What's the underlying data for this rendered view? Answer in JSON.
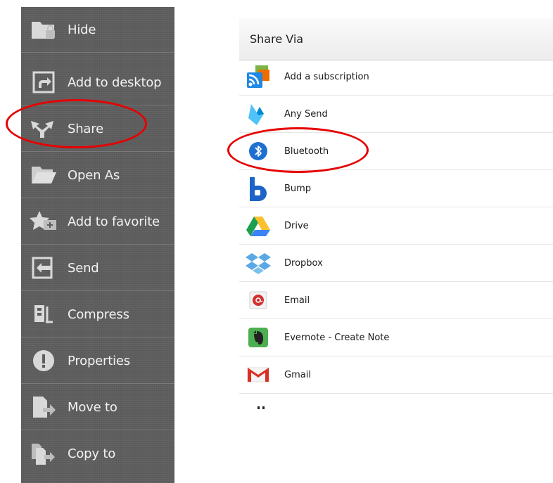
{
  "menu": {
    "items": [
      {
        "label": "Hide",
        "icon": "folder-lock-icon"
      },
      {
        "label": "Add to desktop",
        "icon": "shortcut-icon"
      },
      {
        "label": "Share",
        "icon": "share-icon"
      },
      {
        "label": "Open As",
        "icon": "open-folder-icon"
      },
      {
        "label": "Add to favorite",
        "icon": "star-icon"
      },
      {
        "label": "Send",
        "icon": "send-icon"
      },
      {
        "label": "Compress",
        "icon": "compress-icon"
      },
      {
        "label": "Properties",
        "icon": "info-icon"
      },
      {
        "label": "Move to",
        "icon": "move-icon"
      },
      {
        "label": "Copy to",
        "icon": "copy-icon"
      }
    ]
  },
  "share": {
    "title": "Share Via",
    "items": [
      {
        "label": "Add a subscription",
        "icon": "rss-subscription-icon"
      },
      {
        "label": "Any Send",
        "icon": "any-send-icon"
      },
      {
        "label": "Bluetooth",
        "icon": "bluetooth-icon"
      },
      {
        "label": "Bump",
        "icon": "bump-icon"
      },
      {
        "label": "Drive",
        "icon": "drive-icon"
      },
      {
        "label": "Dropbox",
        "icon": "dropbox-icon"
      },
      {
        "label": "Email",
        "icon": "email-icon"
      },
      {
        "label": "Evernote - Create Note",
        "icon": "evernote-icon"
      },
      {
        "label": "Gmail",
        "icon": "gmail-icon"
      }
    ]
  },
  "colors": {
    "menu_bg": "#5e5e5e",
    "highlight": "#e60000",
    "bluetooth": "#1f6fd0"
  }
}
